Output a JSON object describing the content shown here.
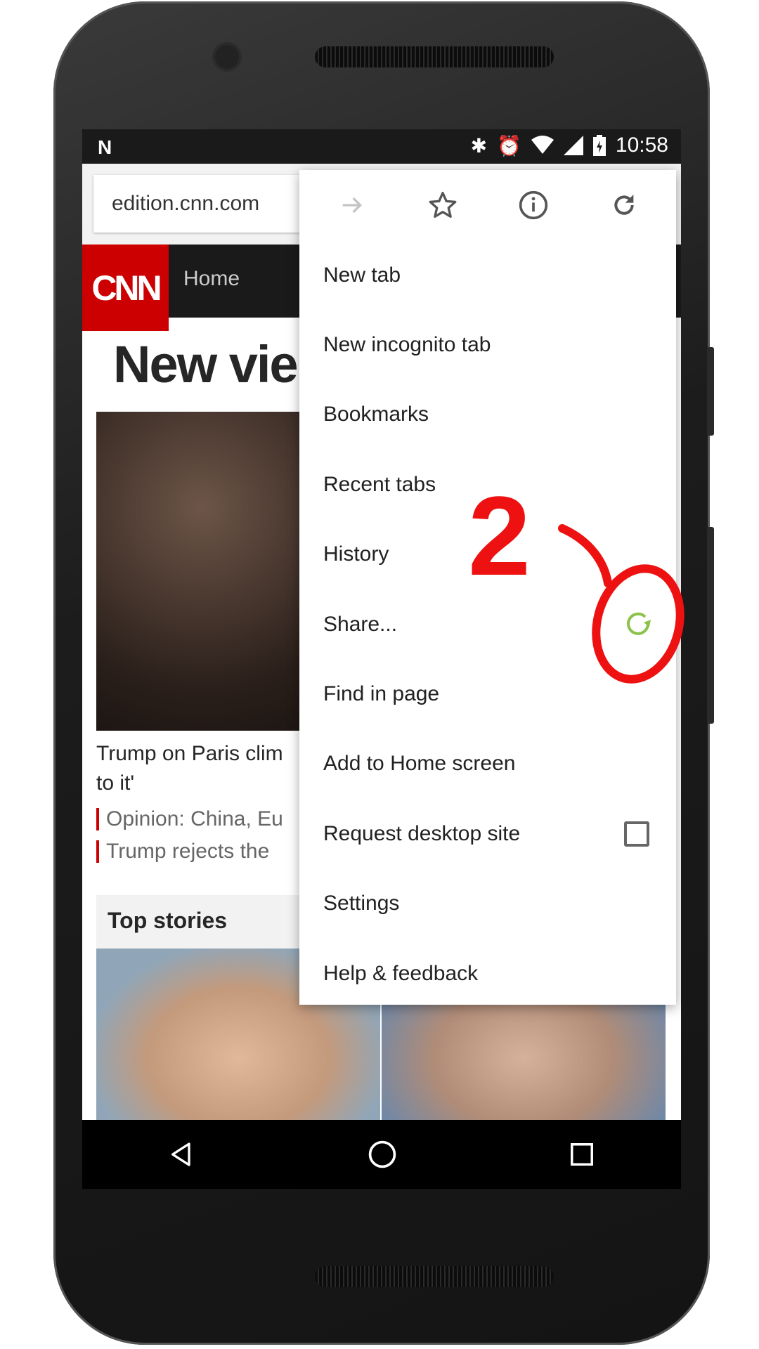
{
  "status_bar": {
    "time": "10:58",
    "notification_icon": "n-icon",
    "icons": [
      "bluetooth-icon",
      "alarm-icon",
      "wifi-icon",
      "signal-icon",
      "battery-charging-icon"
    ]
  },
  "browser": {
    "url": "edition.cnn.com"
  },
  "page": {
    "logo": "CNN",
    "nav_home": "Home",
    "headline": "New vie",
    "story_line1": "Trump on Paris clim",
    "story_line2": "to it'",
    "sub1": "Opinion: China, Eu",
    "sub2": "Trump rejects the",
    "top_stories": "Top stories",
    "accent": "#cc0000"
  },
  "menu": {
    "icons": [
      "forward-icon",
      "star-icon",
      "info-icon",
      "refresh-icon"
    ],
    "items": [
      {
        "label": "New tab"
      },
      {
        "label": "New incognito tab"
      },
      {
        "label": "Bookmarks"
      },
      {
        "label": "Recent tabs"
      },
      {
        "label": "History"
      },
      {
        "label": "Share..."
      },
      {
        "label": "Find in page"
      },
      {
        "label": "Add to Home screen"
      },
      {
        "label": "Request desktop site",
        "checked": false
      },
      {
        "label": "Settings"
      },
      {
        "label": "Help & feedback"
      }
    ]
  },
  "annotation": {
    "step": "2",
    "color": "#ee1111",
    "icon": "refresh-icon",
    "icon_color": "#8bc34a"
  },
  "navbar": {
    "icons": [
      "back-icon",
      "home-icon",
      "recents-icon"
    ]
  }
}
